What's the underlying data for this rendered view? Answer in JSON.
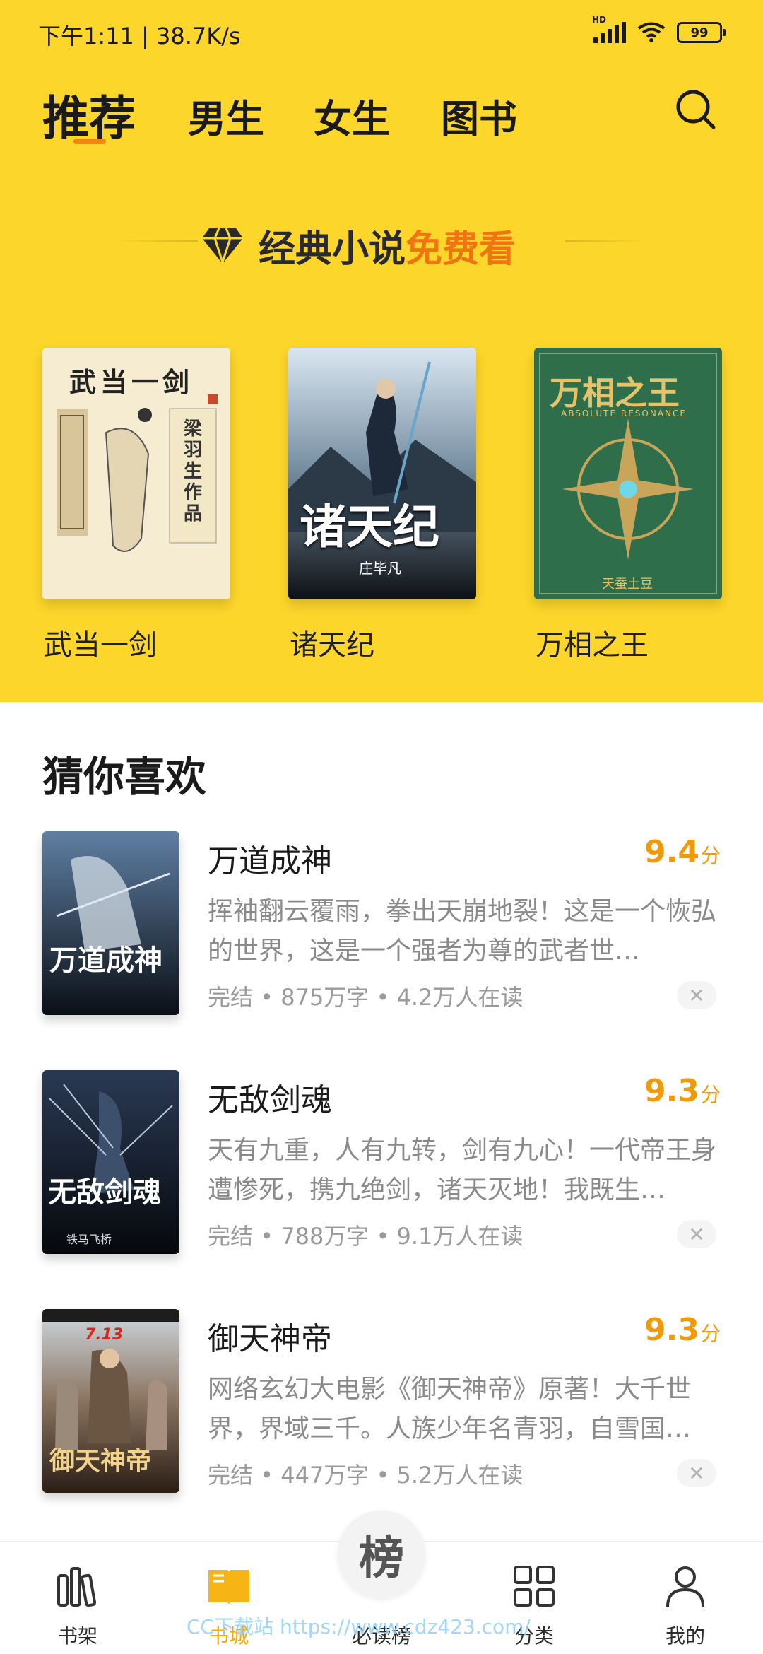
{
  "status_bar": {
    "time": "下午1:11 | 38.7K/s",
    "network": "HD",
    "battery": "99"
  },
  "tabs": [
    {
      "label": "推荐",
      "active": true
    },
    {
      "label": "男生"
    },
    {
      "label": "女生"
    },
    {
      "label": "图书"
    }
  ],
  "promo": {
    "text_prefix": "经典小说",
    "text_highlight": "免费看"
  },
  "featured_books": [
    {
      "title": "武当一剑",
      "cover_text": "武当一剑",
      "cover_author": "梁羽生作品"
    },
    {
      "title": "诸天纪",
      "cover_text": "诸天纪",
      "cover_author": "庄毕凡"
    },
    {
      "title": "万相之王",
      "cover_text": "万相之王",
      "cover_subtitle": "ABSOLUTE RESONANCE",
      "cover_author": "天蚕土豆"
    }
  ],
  "section": {
    "title": "猜你喜欢"
  },
  "books": [
    {
      "name": "万道成神",
      "score": "9.4",
      "score_unit": "分",
      "description": "挥袖翻云覆雨，拳出天崩地裂！这是一个恢弘的世界，这是一个强者为尊的武者世…",
      "meta": "完结 • 875万字 • 4.2万人在读",
      "cover_text": "万道成神"
    },
    {
      "name": "无敌剑魂",
      "score": "9.3",
      "score_unit": "分",
      "description": "天有九重，人有九转，剑有九心！一代帝王身遭惨死，携九绝剑，诸天灭地！我既生…",
      "meta": "完结 • 788万字 • 9.1万人在读",
      "cover_text": "无敌剑魂",
      "cover_author": "铁马飞桥"
    },
    {
      "name": "御天神帝",
      "score": "9.3",
      "score_unit": "分",
      "description": "网络玄幻大电影《御天神帝》原著！大千世界，界域三千。人族少年名青羽，自雪国…",
      "meta": "完结 • 447万字 • 5.2万人在读",
      "cover_text": "御天神帝",
      "cover_date": "7.13"
    }
  ],
  "bottom_nav": [
    {
      "label": "书架",
      "icon": "bookshelf-icon"
    },
    {
      "label": "书城",
      "icon": "open-book-icon",
      "active": true
    },
    {
      "label": "必读榜",
      "icon": "ranking-icon",
      "glyph": "榜"
    },
    {
      "label": "分类",
      "icon": "grid-icon"
    },
    {
      "label": "我的",
      "icon": "person-icon"
    }
  ],
  "watermark": "CC下载站 https://www.cdz423.com/",
  "colors": {
    "brand_yellow": "#fcd62a",
    "accent_orange": "#f07412",
    "score_orange": "#ef9a0a"
  }
}
